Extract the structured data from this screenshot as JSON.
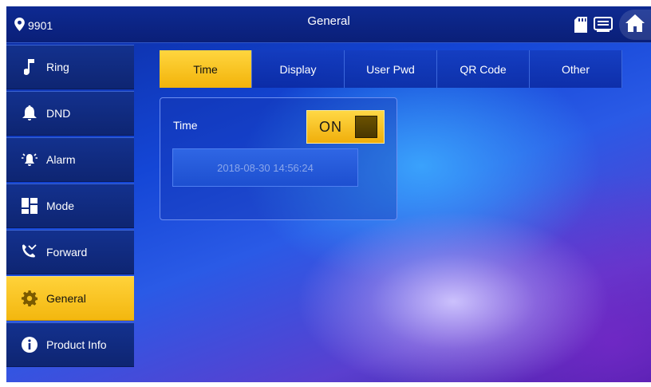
{
  "topbar": {
    "room_number": "9901",
    "title": "General",
    "icons": [
      "location-pin-icon",
      "sd-card-icon",
      "message-icon",
      "home-icon"
    ]
  },
  "sidebar": {
    "items": [
      {
        "label": "Ring",
        "icon": "music-note-icon",
        "active": false
      },
      {
        "label": "DND",
        "icon": "bell-icon",
        "active": false
      },
      {
        "label": "Alarm",
        "icon": "alarm-icon",
        "active": false
      },
      {
        "label": "Mode",
        "icon": "mode-grid-icon",
        "active": false
      },
      {
        "label": "Forward",
        "icon": "call-forward-icon",
        "active": false
      },
      {
        "label": "General",
        "icon": "gear-icon",
        "active": true
      },
      {
        "label": "Product Info",
        "icon": "info-icon",
        "active": false
      }
    ]
  },
  "tabs": [
    {
      "label": "Time",
      "active": true
    },
    {
      "label": "Display",
      "active": false
    },
    {
      "label": "User Pwd",
      "active": false
    },
    {
      "label": "QR Code",
      "active": false
    },
    {
      "label": "Other",
      "active": false
    }
  ],
  "time_panel": {
    "label": "Time",
    "toggle_text": "ON",
    "datetime_value": "2018-08-30 14:56:24"
  },
  "colors": {
    "accent": "#f5bc14",
    "bar": "#0c2480"
  }
}
